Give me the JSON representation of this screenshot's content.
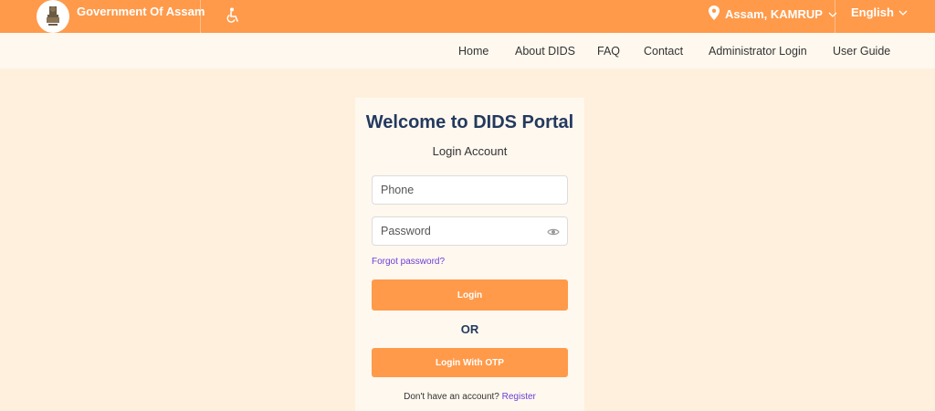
{
  "header": {
    "government_title": "Government Of Assam",
    "location_label": "Assam, KAMRUP",
    "language_label": "English",
    "background_color": "#ff9a4a"
  },
  "nav": {
    "items": [
      "Home",
      "About DIDS",
      "FAQ",
      "Contact",
      "Administrator Login",
      "User Guide"
    ]
  },
  "login": {
    "title": "Welcome to DIDS Portal",
    "subtitle": "Login Account",
    "phone_placeholder": "Phone",
    "password_placeholder": "Password",
    "forgot_label": "Forgot password?",
    "login_button": "Login",
    "or_label": "OR",
    "otp_button": "Login With OTP",
    "signup_prompt": "Don't have an account?",
    "register_link": "Register"
  },
  "icons": {
    "emblem": "state-emblem-icon",
    "accessibility": "accessibility-icon",
    "location": "location-pin-icon",
    "dropdown": "chevron-down-icon",
    "password_toggle": "eye-icon"
  },
  "colors": {
    "accent": "#ff9a4a",
    "page_background": "#fef0dc",
    "title_text": "#233a5e",
    "link": "#6b3fd6"
  }
}
